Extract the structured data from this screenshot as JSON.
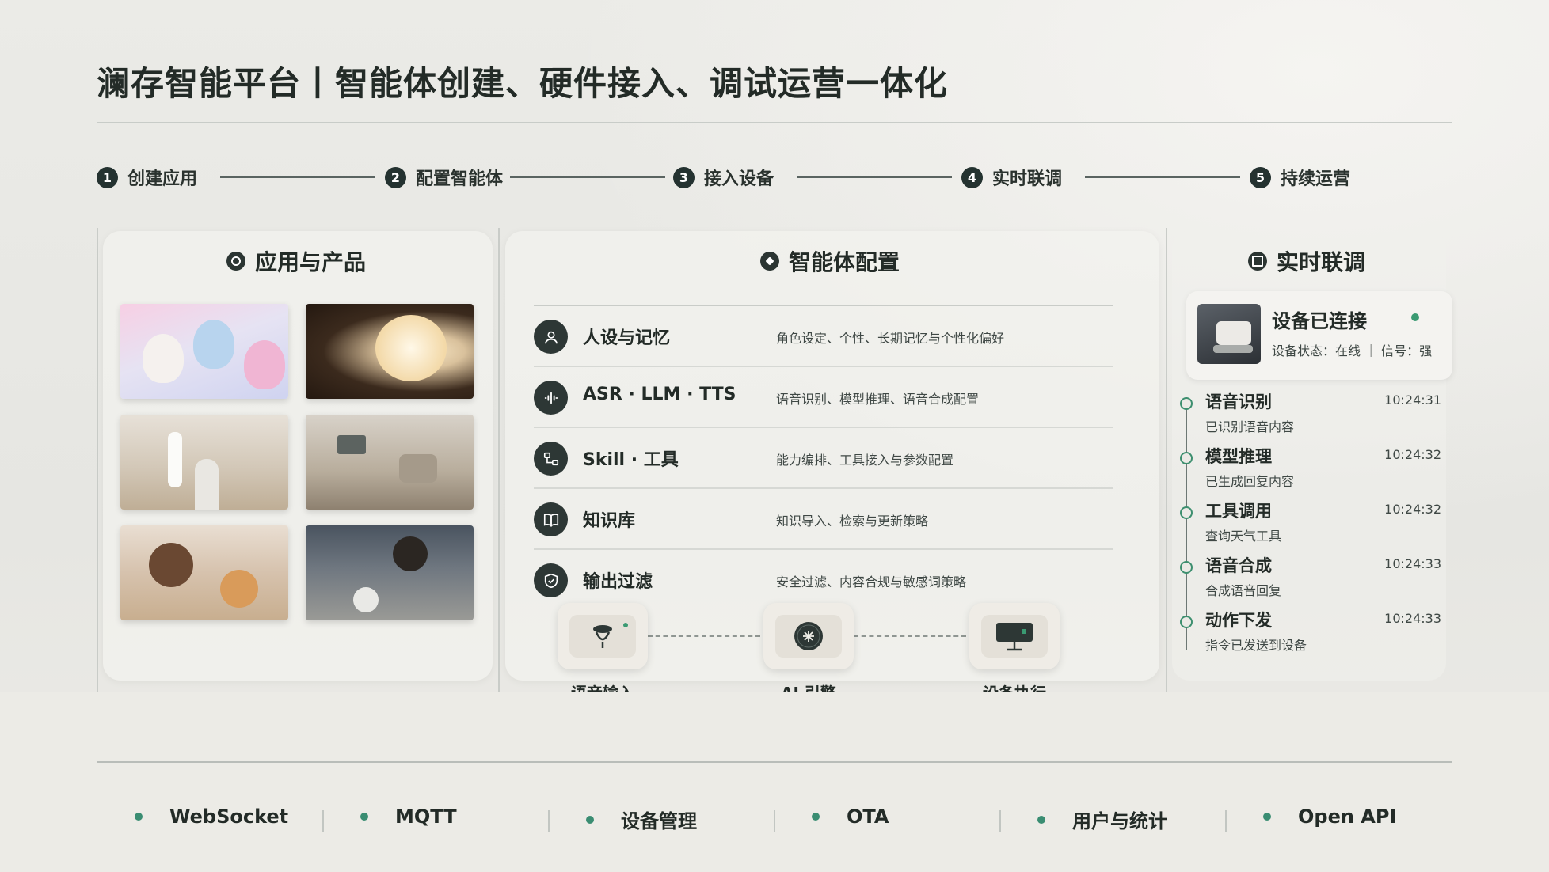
{
  "header": {
    "title": "澜存智能平台丨智能体创建、硬件接入、调试运营一体化"
  },
  "steps": [
    {
      "num": "1",
      "label": "创建应用"
    },
    {
      "num": "2",
      "label": "配置智能体"
    },
    {
      "num": "3",
      "label": "接入设备"
    },
    {
      "num": "4",
      "label": "实时联调"
    },
    {
      "num": "5",
      "label": "持续运营"
    }
  ],
  "apps_panel": {
    "title": "应用与产品"
  },
  "agent_panel": {
    "title": "智能体配置",
    "rows": [
      {
        "name": "人设与记忆",
        "desc": "角色设定、个性、长期记忆与个性化偏好",
        "icon": "persona-icon"
      },
      {
        "name": "ASR · LLM · TTS",
        "desc": "语音识别、模型推理、语音合成配置",
        "icon": "waveform-icon"
      },
      {
        "name": "Skill · 工具",
        "desc": "能力编排、工具接入与参数配置",
        "icon": "tool-flow-icon"
      },
      {
        "name": "知识库",
        "desc": "知识导入、检索与更新策略",
        "icon": "book-icon"
      },
      {
        "name": "输出过滤",
        "desc": "安全过滤、内容合规与敏感词策略",
        "icon": "shield-icon"
      }
    ],
    "flow": [
      {
        "label": "语音输入",
        "icon": "microphone-icon"
      },
      {
        "label": "AI 引擎",
        "icon": "ai-engine-icon"
      },
      {
        "label": "设备执行",
        "icon": "device-screen-icon"
      }
    ]
  },
  "realtime_panel": {
    "title": "实时联调",
    "device": {
      "title": "设备已连接",
      "status_text": "设备状态：在线  ｜  信号：强",
      "status_color": "#3a9a72"
    },
    "events": [
      {
        "title": "语音识别",
        "time": "10:24:31",
        "desc": "已识别语音内容"
      },
      {
        "title": "模型推理",
        "time": "10:24:32",
        "desc": "已生成回复内容"
      },
      {
        "title": "工具调用",
        "time": "10:24:32",
        "desc": "查询天气工具"
      },
      {
        "title": "语音合成",
        "time": "10:24:33",
        "desc": "合成语音回复"
      },
      {
        "title": "动作下发",
        "time": "10:24:33",
        "desc": "指令已发送到设备"
      }
    ]
  },
  "footer": {
    "items": [
      "WebSocket",
      "MQTT",
      "设备管理",
      "OTA",
      "用户与统计",
      "Open API"
    ]
  },
  "colors": {
    "accent": "#3a8d72",
    "dark": "#243230"
  }
}
